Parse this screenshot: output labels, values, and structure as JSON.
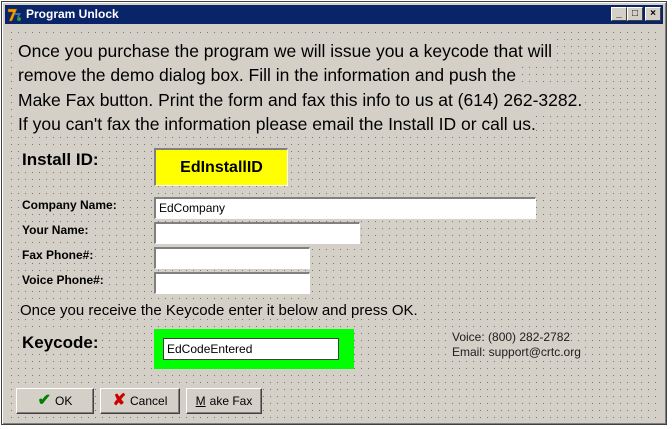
{
  "window": {
    "title": "Program Unlock",
    "controls": {
      "minimize": "_",
      "maximize": "□",
      "close": "×"
    }
  },
  "intro": {
    "lines": [
      "Once you purchase the program we will issue you a keycode that will",
      "remove the demo dialog box. Fill in the information and push the",
      "Make Fax button. Print the form and fax this info to us at (614) 262-3282.",
      "If you can't fax the information please email the Install ID or call us."
    ]
  },
  "form": {
    "install_id_label": "Install ID:",
    "install_id_value": "EdInstallID",
    "company_label": "Company Name:",
    "company_value": "EdCompany",
    "name_label": "Your Name:",
    "name_value": "",
    "fax_label": "Fax Phone#:",
    "fax_value": "",
    "voice_label": "Voice Phone#:",
    "voice_value": ""
  },
  "keycode": {
    "instruction": "Once you receive the Keycode enter it below and press OK.",
    "label": "Keycode:",
    "value": "EdCodeEntered"
  },
  "contact": {
    "voice": "Voice: (800) 282-2782",
    "email": "Email: support@crtc.org"
  },
  "buttons": {
    "ok": "OK",
    "cancel": "Cancel",
    "make_fax": "Make Fax"
  },
  "colors": {
    "title_bar": "#0a246a",
    "install_id_bg": "#ffff00",
    "keycode_frame": "#00ff00",
    "ok_icon": "#008000",
    "cancel_icon": "#cc0000"
  },
  "icons": {
    "app": "app-logo-icon",
    "ok": "checkmark-icon",
    "cancel": "x-mark-icon"
  }
}
